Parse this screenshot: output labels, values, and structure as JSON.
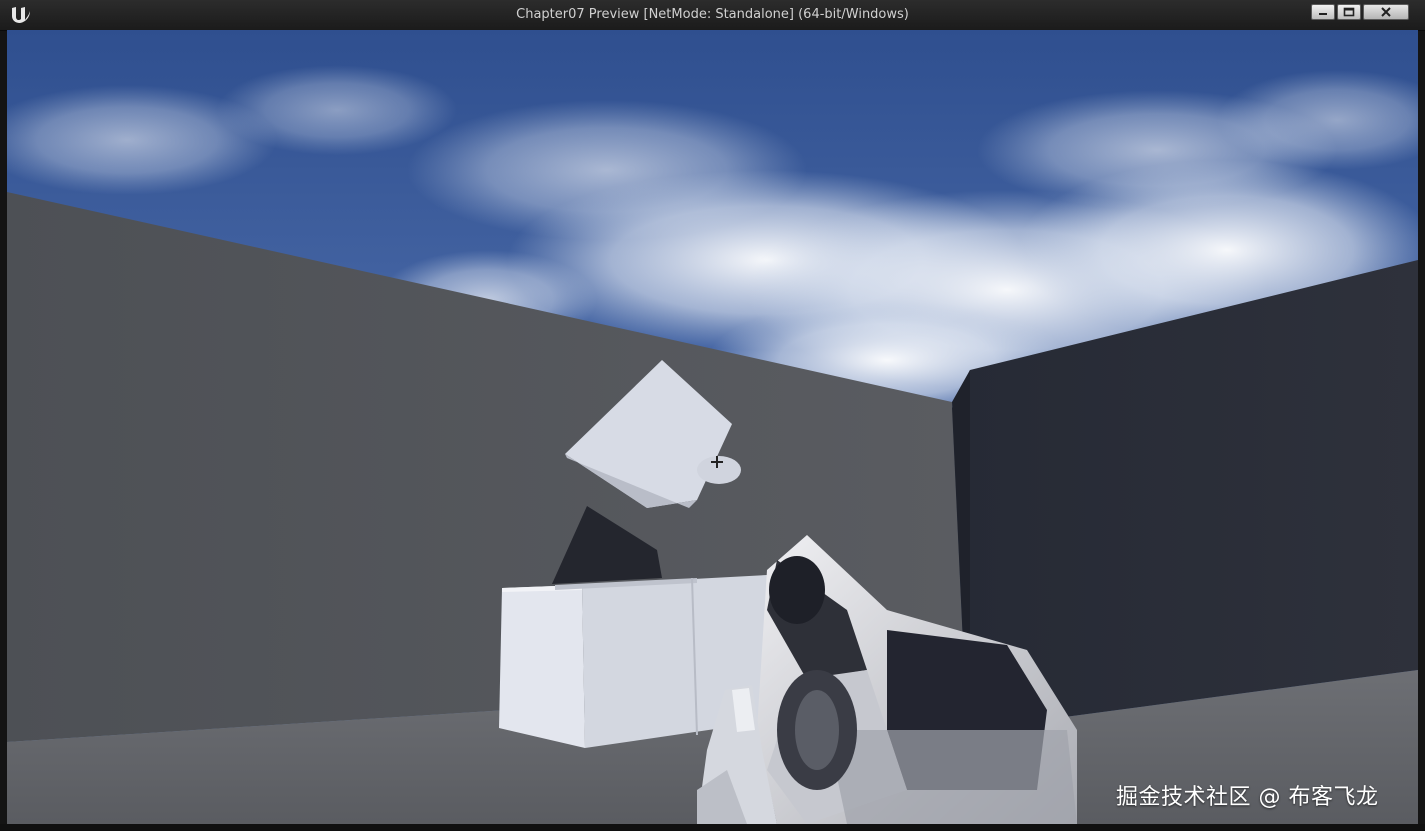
{
  "window": {
    "title": "Chapter07 Preview [NetMode: Standalone] (64-bit/Windows)",
    "controls": {
      "minimize_icon": "minimize-icon",
      "maximize_icon": "maximize-icon",
      "close_icon": "close-icon"
    }
  },
  "viewport": {
    "scene_type": "first-person-game-view",
    "crosshair_icon": "crosshair-icon"
  },
  "watermark": {
    "text": "掘金技术社区 @ 布客飞龙"
  },
  "colors": {
    "titlebar": "#222222",
    "sky": "#3d5d9a",
    "wall_left": "#55585d",
    "wall_right": "#2a2d37",
    "floor": "#5e6065",
    "cube": "#d9dde6"
  }
}
